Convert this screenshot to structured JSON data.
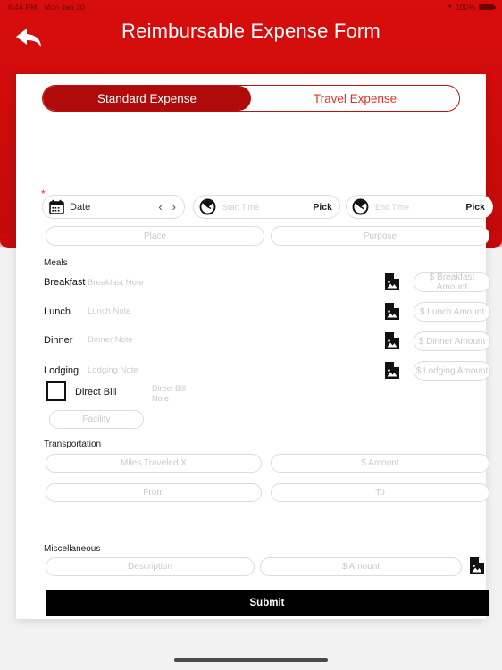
{
  "status_bar": {
    "time": "6:44 PM",
    "date": "Mon Jan 20",
    "battery_percent": "100%",
    "wifi_icon": "wifi-icon",
    "battery_icon": "battery-icon"
  },
  "header": {
    "title": "Reimbursable Expense Form",
    "back_icon": "back-arrow-icon",
    "background_color": "#cc0b0b"
  },
  "segmented_control": {
    "options": [
      {
        "label": "Standard Expense",
        "selected": true
      },
      {
        "label": "Travel Expense",
        "selected": false
      }
    ],
    "active_color": "#b00b0b",
    "inactive_text_color": "#e0332f"
  },
  "date_row": {
    "required_marker": "*",
    "calendar_icon": "calendar-icon",
    "date_label": "Date",
    "prev_icon": "chevron-left-icon",
    "next_icon": "chevron-right-icon",
    "start_time": {
      "clock_icon": "clock-icon",
      "placeholder": "Start Time",
      "pick_label": "Pick"
    },
    "end_time": {
      "clock_icon": "clock-icon",
      "placeholder": "End Time",
      "pick_label": "Pick"
    }
  },
  "place_purpose": {
    "place_placeholder": "Place",
    "purpose_placeholder": "Purpose"
  },
  "meals": {
    "heading": "Meals",
    "rows": [
      {
        "label": "Breakfast",
        "note_placeholder": "Breakfast Note",
        "attachment_icon": "document-attachment-icon",
        "amount_placeholder": "$ Breakfast Amount"
      },
      {
        "label": "Lunch",
        "note_placeholder": "Lunch Note",
        "attachment_icon": "document-attachment-icon",
        "amount_placeholder": "$ Lunch Amount"
      },
      {
        "label": "Dinner",
        "note_placeholder": "Dinner Note",
        "attachment_icon": "document-attachment-icon",
        "amount_placeholder": "$ Dinner Amount"
      }
    ]
  },
  "lodging": {
    "label": "Lodging",
    "note_placeholder": "Lodging Note",
    "attachment_icon": "document-attachment-icon",
    "amount_placeholder": "$ Lodging Amount",
    "direct_bill": {
      "checkbox_icon": "checkbox-unchecked-icon",
      "checked": false,
      "label": "Direct Bill",
      "note_placeholder": "Direct Bill Note"
    },
    "facility_placeholder": "Facility"
  },
  "transportation": {
    "heading": "Transportation",
    "miles_placeholder": "Miles Traveled X",
    "amount_placeholder": "$ Amount",
    "from_placeholder": "From",
    "to_placeholder": "To"
  },
  "miscellaneous": {
    "heading": "Miscellaneous",
    "description_placeholder": "Description",
    "amount_placeholder": "$ Amount",
    "attachment_icon": "document-attachment-icon"
  },
  "submit": {
    "label": "Submit",
    "background_color": "#000000"
  }
}
